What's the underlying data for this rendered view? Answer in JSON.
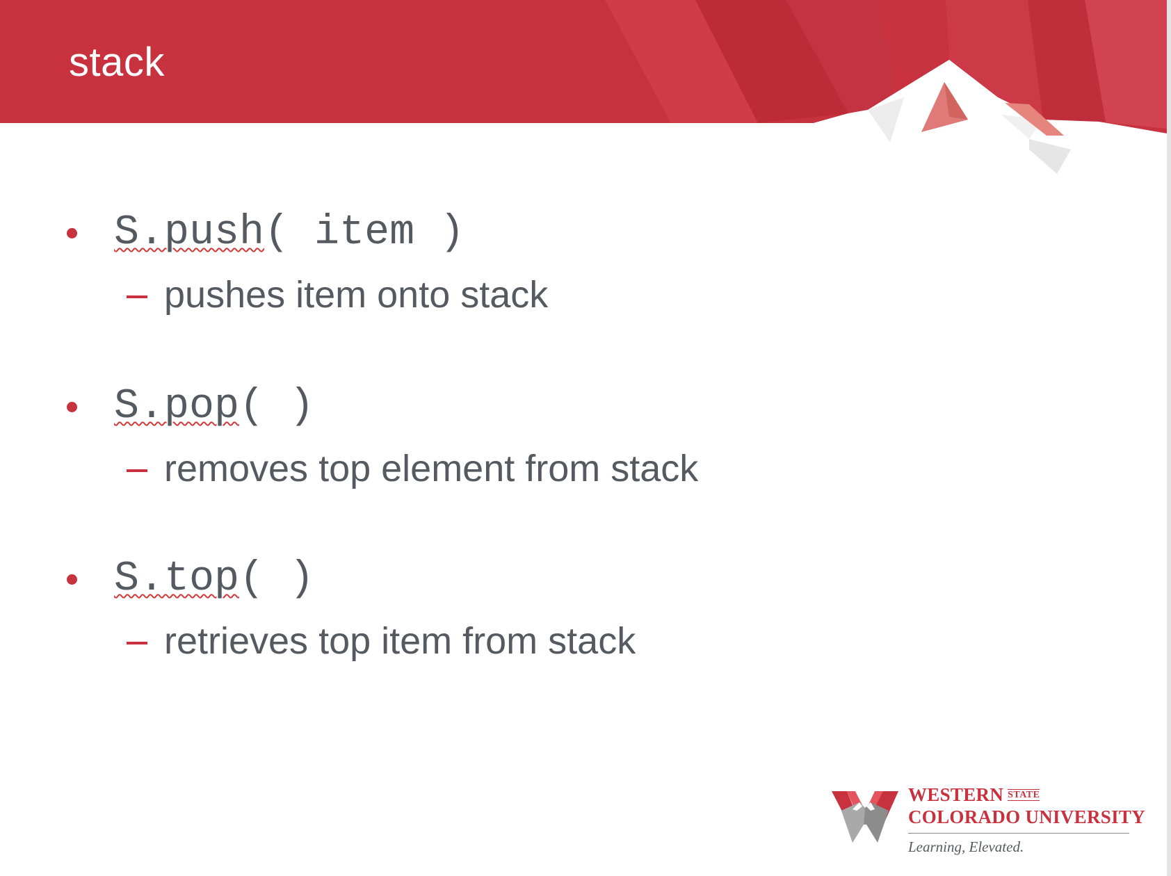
{
  "slide": {
    "title": "stack",
    "bullets": [
      {
        "code_squiggle": "S.push",
        "code_rest": "( item )",
        "description": "pushes item onto stack"
      },
      {
        "code_squiggle": "S.pop",
        "code_rest": "( )",
        "description": "removes top element from stack"
      },
      {
        "code_squiggle": "S.top",
        "code_rest": "( )",
        "description": "retrieves top item from stack"
      }
    ]
  },
  "logo": {
    "line1": "WESTERN",
    "state": "STATE",
    "line2": "COLORADO UNIVERSITY",
    "tagline": "Learning, Elevated."
  },
  "colors": {
    "header_red": "#c8323f",
    "text_gray": "#555a60",
    "accent_red": "#c8323f"
  }
}
